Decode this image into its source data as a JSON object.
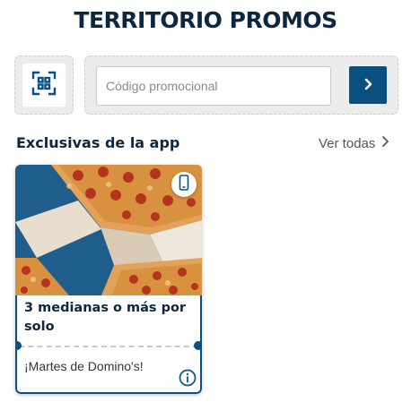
{
  "header": {
    "title": "TERRITORIO PROMOS"
  },
  "promo": {
    "scan_icon": "qr-scan-icon",
    "input_placeholder": "Código promocional",
    "input_value": "",
    "submit_icon": "chevron-right-icon"
  },
  "section": {
    "title": "Exclusivas de la app",
    "see_all_label": "Ver todas",
    "see_all_icon": "chevron-right-icon"
  },
  "cards": [
    {
      "image": "pizza-boxes-photo",
      "badge_icon": "mobile-phone-icon",
      "title": "3 medianas o más por solo",
      "subtitle": "¡Martes de Domino's!",
      "info_icon": "info-icon"
    }
  ],
  "colors": {
    "brand_blue": "#0a5180",
    "title_navy": "#0e2740",
    "dashed_bg": "#ececec"
  }
}
